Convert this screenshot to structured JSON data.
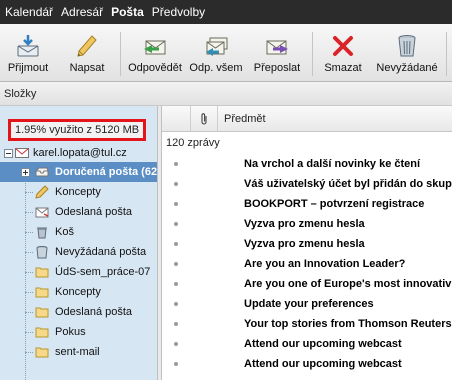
{
  "topnav": {
    "tabs": [
      {
        "label": "Kalendář",
        "active": false
      },
      {
        "label": "Adresář",
        "active": false
      },
      {
        "label": "Pošta",
        "active": true
      },
      {
        "label": "Předvolby",
        "active": false
      }
    ]
  },
  "toolbar": {
    "receive": "Přijmout",
    "compose": "Napsat",
    "reply": "Odpovědět",
    "reply_all": "Odp. všem",
    "forward": "Přeposlat",
    "delete": "Smazat",
    "spam": "Nevyžádané"
  },
  "folders_header": "Složky",
  "quota": "1.95% využito z 5120 MB",
  "account": "karel.lopata@tul.cz",
  "folders": [
    {
      "name": "Doručená pošta (62",
      "icon": "inbox-icon",
      "selected": true
    },
    {
      "name": "Koncepty",
      "icon": "pencil-icon",
      "selected": false
    },
    {
      "name": "Odeslaná pošta",
      "icon": "sent-icon",
      "selected": false
    },
    {
      "name": "Koš",
      "icon": "trash-icon",
      "selected": false
    },
    {
      "name": "Nevyžádaná pošta",
      "icon": "spam-icon",
      "selected": false
    },
    {
      "name": "ÚdS-sem_práce-07",
      "icon": "folder-icon",
      "selected": false
    },
    {
      "name": "Koncepty",
      "icon": "folder-icon",
      "selected": false
    },
    {
      "name": "Odeslaná pošta",
      "icon": "folder-icon",
      "selected": false
    },
    {
      "name": "Pokus",
      "icon": "folder-icon",
      "selected": false
    },
    {
      "name": "sent-mail",
      "icon": "folder-icon",
      "selected": false
    }
  ],
  "message_list": {
    "column_subject": "Předmět",
    "count": "120 zprávy",
    "messages": [
      "Na vrchol a další novinky ke čtení",
      "Váš uživatelský účet byl přidán do skup",
      "BOOKPORT – potvrzení registrace",
      "Vyzva pro zmenu hesla",
      "Vyzva pro zmenu hesla",
      "Are you an Innovation Leader?",
      "Are you one of Europe's most innovativ",
      "Update your preferences",
      "Your top stories from Thomson Reuters",
      "Attend our upcoming webcast",
      "Attend our upcoming webcast"
    ]
  },
  "colors": {
    "topnav_bg": "#2b2b2b",
    "folder_pane_bg": "#d7e6f3",
    "selected_folder_bg": "#5a8ec4",
    "quota_border": "#e4141b"
  }
}
